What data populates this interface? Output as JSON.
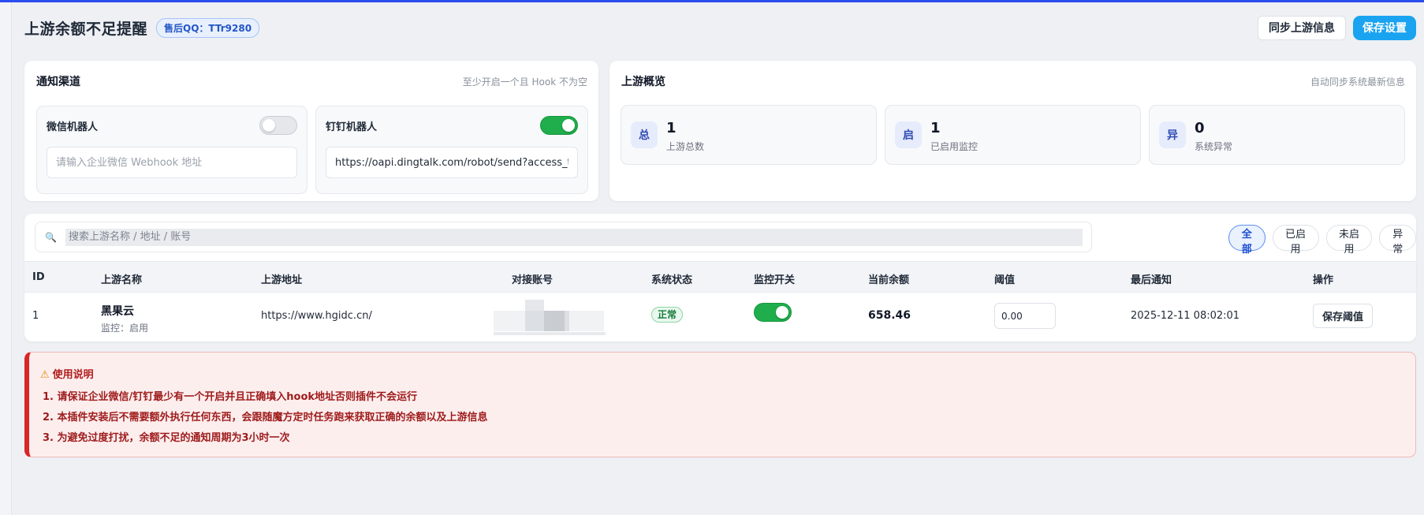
{
  "header": {
    "title": "上游余额不足提醒",
    "qq_badge": "售后QQ：TTr9280",
    "sync_button": "同步上游信息",
    "save_button": "保存设置"
  },
  "notify": {
    "title": "通知渠道",
    "hint": "至少开启一个且 Hook 不为空",
    "wechat": {
      "label": "微信机器人",
      "enabled": false,
      "placeholder": "请输入企业微信 Webhook 地址",
      "value": ""
    },
    "dingtalk": {
      "label": "钉钉机器人",
      "enabled": true,
      "placeholder": "",
      "value": "https://oapi.dingtalk.com/robot/send?access_token"
    }
  },
  "overview": {
    "title": "上游概览",
    "hint": "自动同步系统最新信息",
    "stats": [
      {
        "icon": "总",
        "value": "1",
        "label": "上游总数"
      },
      {
        "icon": "启",
        "value": "1",
        "label": "已启用监控"
      },
      {
        "icon": "异",
        "value": "0",
        "label": "系统异常"
      }
    ]
  },
  "search": {
    "placeholder": "搜索上游名称 / 地址 / 账号",
    "icon": "search-icon"
  },
  "filters": [
    "全部",
    "已启用",
    "未启用",
    "异常"
  ],
  "active_filter": "全部",
  "table": {
    "columns": [
      "ID",
      "上游名称",
      "上游地址",
      "对接账号",
      "系统状态",
      "监控开关",
      "当前余额",
      "阈值",
      "最后通知",
      "操作"
    ],
    "rows": [
      {
        "id": "1",
        "name": "黑果云",
        "monitor_text": "监控：启用",
        "url": "https://www.hgidc.cn/",
        "account": "",
        "status": "正常",
        "monitor_on": true,
        "balance": "658.46",
        "threshold": "0.00",
        "last_notify": "2025-12-11 08:02:01",
        "action": "保存阈值"
      }
    ]
  },
  "notice": {
    "title": "使用说明",
    "lines": [
      "1. 请保证企业微信/钉钉最少有一个开启并且正确填入hook地址否则插件不会运行",
      "2. 本插件安装后不需要额外执行任何东西，会跟随魔方定时任务跑来获取正确的余额以及上游信息",
      "3. 为避免过度打扰，余额不足的通知周期为3小时一次"
    ]
  },
  "colors": {
    "accent": "#1aa3f0",
    "top_line": "#2b4df0",
    "toggle_on": "#1fae4b",
    "notice_border": "#d92626"
  }
}
